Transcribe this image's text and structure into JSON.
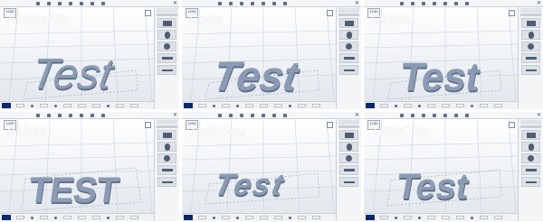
{
  "panels": [
    {
      "font_name": "Amaranth",
      "render_text": "Test"
    },
    {
      "font_name": "Coda",
      "render_text": "Test"
    },
    {
      "font_name": "Candal",
      "render_text": "Test"
    },
    {
      "font_name": "Bebas",
      "render_text": "TEST"
    },
    {
      "font_name": "Techniqu",
      "render_text": "Test"
    },
    {
      "font_name": "TitanOne",
      "render_text": "Test"
    }
  ],
  "ui": {
    "logo_text": "123D",
    "sidebar_tab": "Primitives",
    "sidebar_section": "Basic Primitives"
  },
  "colors": {
    "text_extrusion": "#8a9bb3",
    "text_extrusion_side": "#5f7189",
    "material_swatch": "#0b2a6b",
    "viewport_top": "#ffffff",
    "viewport_bottom": "#e3e8ee"
  },
  "icons": [
    "close-icon",
    "view-cube-icon",
    "primitive-box-icon",
    "primitive-cylinder-icon",
    "primitive-sphere-icon"
  ]
}
